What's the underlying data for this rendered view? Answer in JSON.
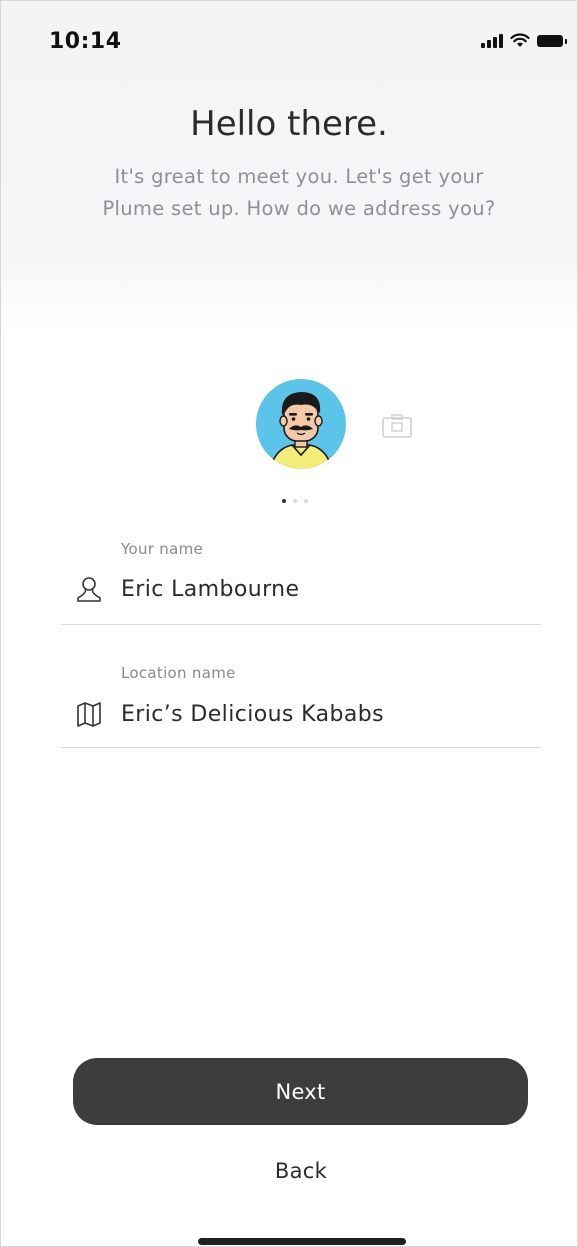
{
  "status_bar": {
    "time": "10:14",
    "icons": [
      "signal-icon",
      "wifi-icon",
      "battery-icon"
    ]
  },
  "header": {
    "title": "Hello there.",
    "subtitle_line1": "It's great to meet you. Let's get your",
    "subtitle_line2": "Plume set up. How do we address you?"
  },
  "avatar": {
    "icon": "avatar-illustration",
    "background_color": "#5bc4e8",
    "carousel_total": 3,
    "carousel_active": 1
  },
  "form": {
    "name_field": {
      "label": "Your name",
      "value": "Eric Lambourne",
      "icon": "person-icon"
    },
    "location_field": {
      "label": "Location name",
      "value": "Eric’s Delicious Kababs",
      "icon": "map-icon"
    }
  },
  "actions": {
    "next_label": "Next",
    "back_label": "Back"
  },
  "colors": {
    "primary_button": "#3d3d3d",
    "text_primary": "#2b2b2b",
    "text_secondary": "#8f9094"
  }
}
